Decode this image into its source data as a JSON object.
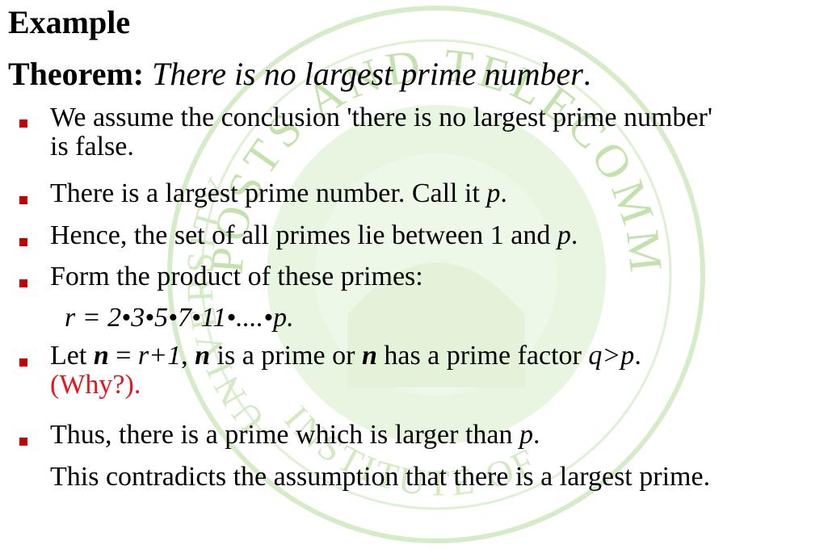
{
  "watermark": {
    "text_top": "POSTS AND TELECOMMUNICATIONS",
    "text_left": "UNIVERSITY OF",
    "text_bottom": "INSTITUTE OF",
    "color": "#9ccc7c"
  },
  "heading": "Example",
  "theorem": {
    "label": "Theorem:",
    "statement": "There is no largest prime number",
    "period": "."
  },
  "bullets": {
    "b1": {
      "line1": "We assume the conclusion 'there is no largest prime number'",
      "line2": "is false."
    },
    "b2": {
      "text": "There is a largest prime number. Call it ",
      "var": "p",
      "end": "."
    },
    "b3": {
      "text": "Hence, the set of all primes lie between 1 and ",
      "var": "p",
      "end": "."
    },
    "b4": {
      "text": "Form the product of these primes:",
      "formula": "r = 2•3•5•7•11•....•p."
    },
    "b5": {
      "t1": "Let ",
      "n1": "n",
      "t2": " = ",
      "r1": "r+1",
      "t3": ", ",
      "n2": "n",
      "t4": " is a prime or ",
      "n3": "n",
      "t5": " has a prime factor ",
      "q": "q>p",
      "t6": ".",
      "why": "(Why?)."
    },
    "b6": {
      "text": "Thus, there is a prime which is larger than ",
      "var": "p",
      "end": ".",
      "line2": "This contradicts the assumption that there is a largest  prime."
    }
  },
  "colors": {
    "bullet_marker": "#c00000",
    "why_text": "#e8141c"
  }
}
